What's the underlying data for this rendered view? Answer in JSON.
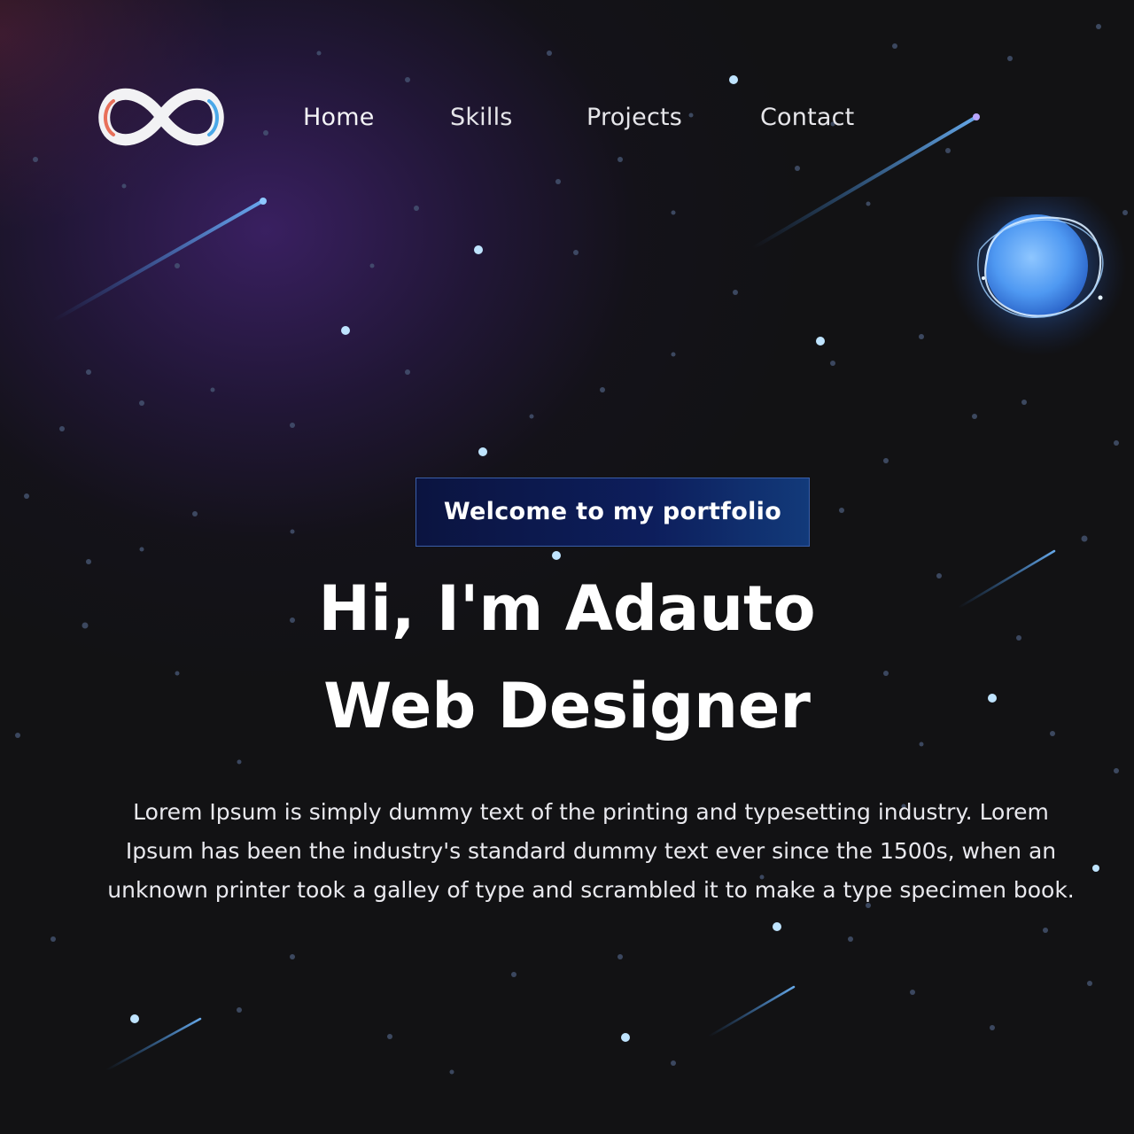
{
  "nav": {
    "logo_icon": "infinity-logo-icon",
    "items": [
      {
        "label": "Home"
      },
      {
        "label": "Skills"
      },
      {
        "label": "Projects"
      },
      {
        "label": "Contact"
      }
    ]
  },
  "hero": {
    "badge": "Welcome to my portfolio",
    "title_line1": "Hi, I'm Adauto",
    "title_line2": "Web Designer",
    "description": "Lorem Ipsum is simply dummy text of the printing and typesetting industry. Lorem Ipsum has been the industry's standard dummy text ever since the 1500s, when an unknown printer took a galley of type and scrambled it to make a type specimen book."
  },
  "colors": {
    "background": "#121214",
    "accent_blue": "#3a8ee8",
    "badge_bg": "#0d1e5c",
    "logo_left": "#e86a5a",
    "logo_right": "#4aa8e8"
  },
  "decorations": {
    "planet_icon": "glowing-planet-icon",
    "shooting_star_icon": "shooting-star-icon",
    "star_icon": "star-dot-icon"
  }
}
